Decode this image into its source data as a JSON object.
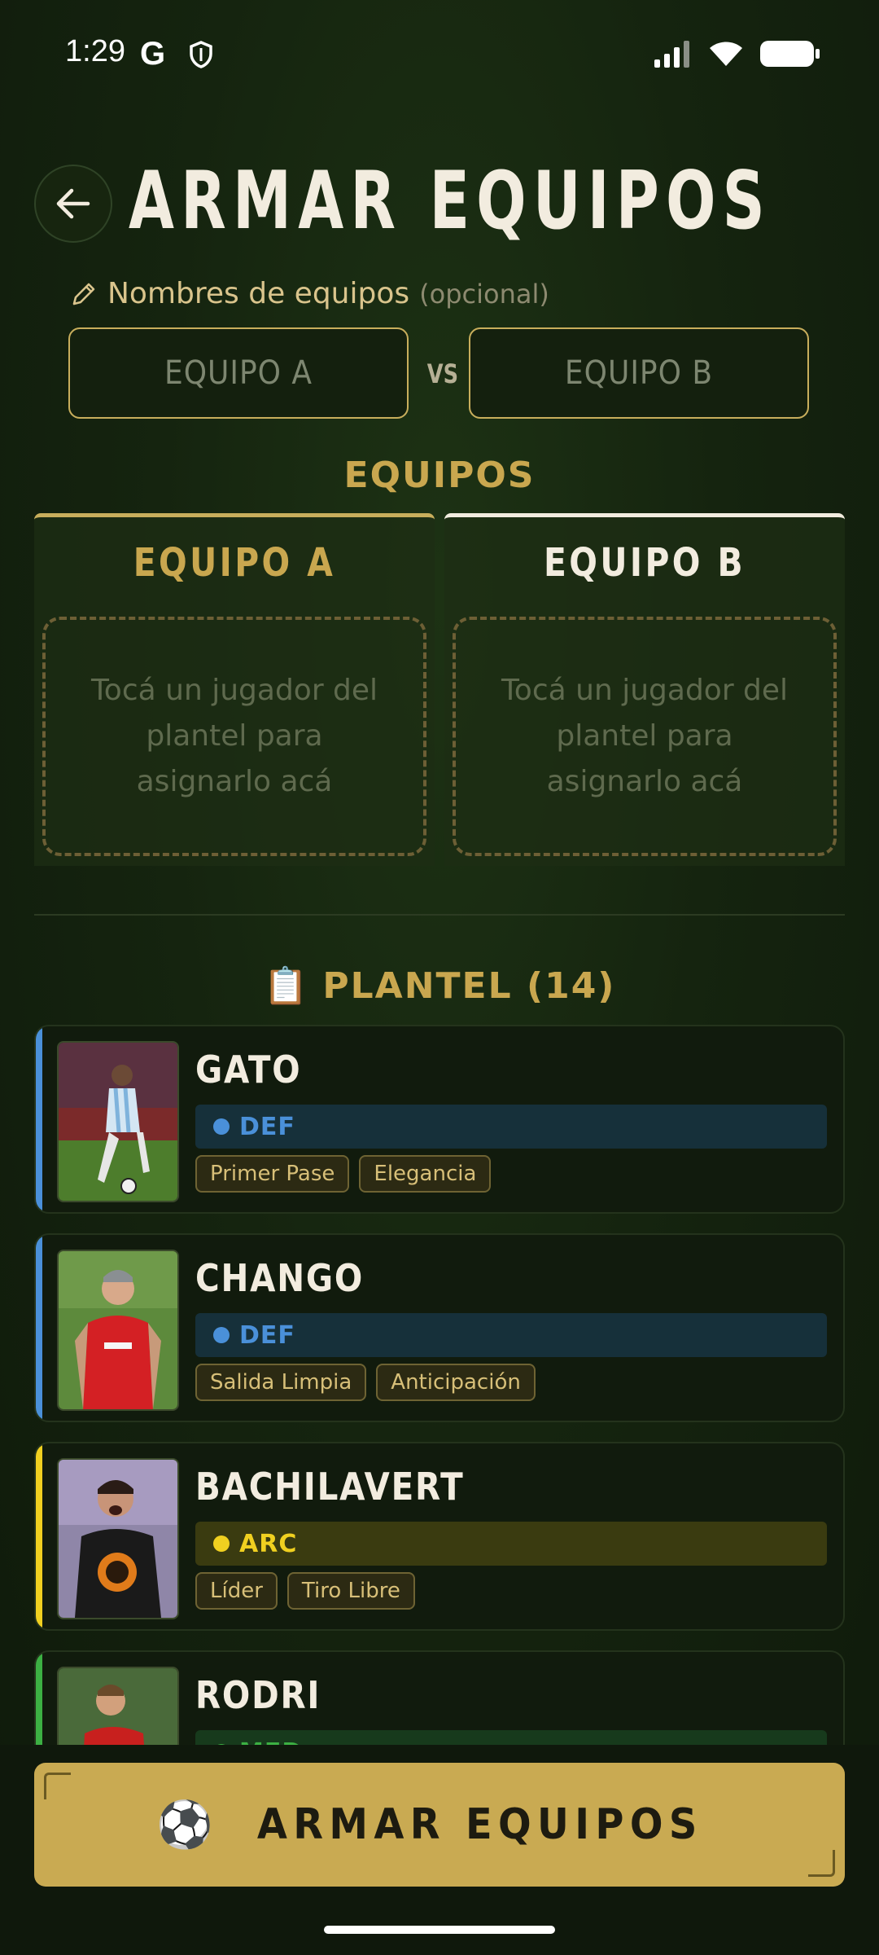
{
  "status_bar": {
    "time": "1:29",
    "g_label": "G"
  },
  "header": {
    "title": "ARMAR EQUIPOS"
  },
  "team_names": {
    "label": "Nombres de equipos",
    "optional": "(opcional)",
    "team_a_placeholder": "EQUIPO A",
    "team_b_placeholder": "EQUIPO B",
    "vs": "VS"
  },
  "teams": {
    "heading": "EQUIPOS",
    "team_a": {
      "title": "EQUIPO A",
      "empty": "Tocá un jugador del plantel para asignarlo acá"
    },
    "team_b": {
      "title": "EQUIPO B",
      "empty": "Tocá un jugador del plantel para asignarlo acá"
    }
  },
  "plantel": {
    "icon": "📋",
    "heading": "PLANTEL (14)",
    "players": [
      {
        "name": "GATO",
        "position": "DEF",
        "position_color": "#4a90d9",
        "tags": [
          "Primer Pase",
          "Elegancia"
        ]
      },
      {
        "name": "CHANGO",
        "position": "DEF",
        "position_color": "#4a90d9",
        "tags": [
          "Salida Limpia",
          "Anticipación"
        ]
      },
      {
        "name": "BACHILAVERT",
        "position": "ARC",
        "position_color": "#f0d020",
        "tags": [
          "Líder",
          "Tiro Libre"
        ]
      },
      {
        "name": "RODRI",
        "position": "MED",
        "position_color": "#3cb043",
        "tags": []
      }
    ]
  },
  "cta": {
    "icon": "⚽",
    "label": "ARMAR EQUIPOS"
  },
  "colors": {
    "accent": "#c9aa52",
    "background": "#15240f"
  }
}
